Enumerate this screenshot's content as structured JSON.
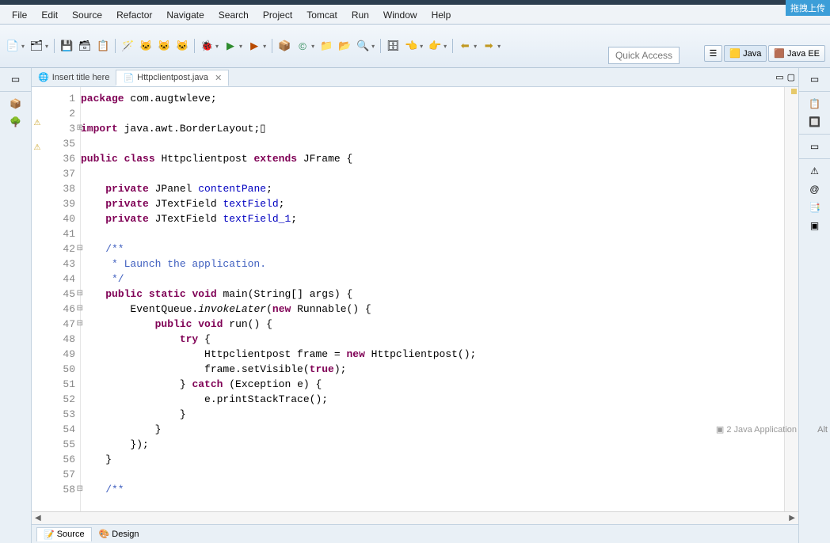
{
  "corner_badge": "拖拽上传",
  "menu": [
    "File",
    "Edit",
    "Source",
    "Refactor",
    "Navigate",
    "Search",
    "Project",
    "Tomcat",
    "Run",
    "Window",
    "Help"
  ],
  "quick_access": "Quick Access",
  "perspectives": {
    "java": "Java",
    "javaee": "Java EE"
  },
  "tabs": {
    "t1": {
      "label": "Insert title here",
      "close": ""
    },
    "t2": {
      "label": "Httpclientpost.java",
      "close": "✕"
    }
  },
  "tab_controls": {
    "min": "▭",
    "max": "▢"
  },
  "line_numbers": [
    "1",
    "2",
    "3",
    "35",
    "36",
    "37",
    "38",
    "39",
    "40",
    "41",
    "42",
    "43",
    "44",
    "45",
    "46",
    "47",
    "48",
    "49",
    "50",
    "51",
    "52",
    "53",
    "54",
    "55",
    "56",
    "57",
    "58"
  ],
  "code": {
    "l1": {
      "kw1": "package",
      "pkg": " com.augtwleve;"
    },
    "l3": {
      "kw1": "import",
      "rest": " java.awt.BorderLayout;",
      "box": "▯"
    },
    "l36": {
      "kw1": "public",
      "kw2": "class",
      "cls": " Httpclientpost ",
      "kw3": "extends",
      "sup": " JFrame {"
    },
    "l38": {
      "pad": "    ",
      "kw1": "private",
      "typ": " JPanel ",
      "fld": "contentPane",
      "end": ";"
    },
    "l39": {
      "pad": "    ",
      "kw1": "private",
      "typ": " JTextField ",
      "fld": "textField",
      "end": ";"
    },
    "l40": {
      "pad": "    ",
      "kw1": "private",
      "typ": " JTextField ",
      "fld": "textField_1",
      "end": ";"
    },
    "l42": {
      "txt": "    /**"
    },
    "l43": {
      "txt": "     * Launch the application."
    },
    "l44": {
      "txt": "     */"
    },
    "l45": {
      "pad": "    ",
      "kw1": "public",
      "kw2": "static",
      "kw3": "void",
      "name": " main(String[] args) {"
    },
    "l46": {
      "pad": "        ",
      "pre": "EventQueue.",
      "inv": "invokeLater",
      "rest": "(",
      "kw": "new",
      "rest2": " Runnable() {"
    },
    "l47": {
      "pad": "            ",
      "kw1": "public",
      "kw2": "void",
      "rest": " run() {"
    },
    "l48": {
      "pad": "                ",
      "kw": "try",
      "rest": " {"
    },
    "l49": {
      "pad": "                    ",
      "pre": "Httpclientpost frame = ",
      "kw": "new",
      "rest": " Httpclientpost();"
    },
    "l50": {
      "pad": "                    ",
      "pre": "frame.setVisible(",
      "kw": "true",
      "rest": ");"
    },
    "l51": {
      "pad": "                ",
      "pre": "} ",
      "kw": "catch",
      "rest": " (Exception e) {"
    },
    "l52": {
      "txt": "                    e.printStackTrace();"
    },
    "l53": {
      "txt": "                }"
    },
    "l54": {
      "txt": "            }"
    },
    "l55": {
      "txt": "        });"
    },
    "l56": {
      "txt": "    }"
    },
    "l58": {
      "txt": "    /**"
    }
  },
  "bottom_tabs": {
    "source": "Source",
    "design": "Design"
  },
  "float_label": "2 Java Application",
  "alt_label": "Alt"
}
